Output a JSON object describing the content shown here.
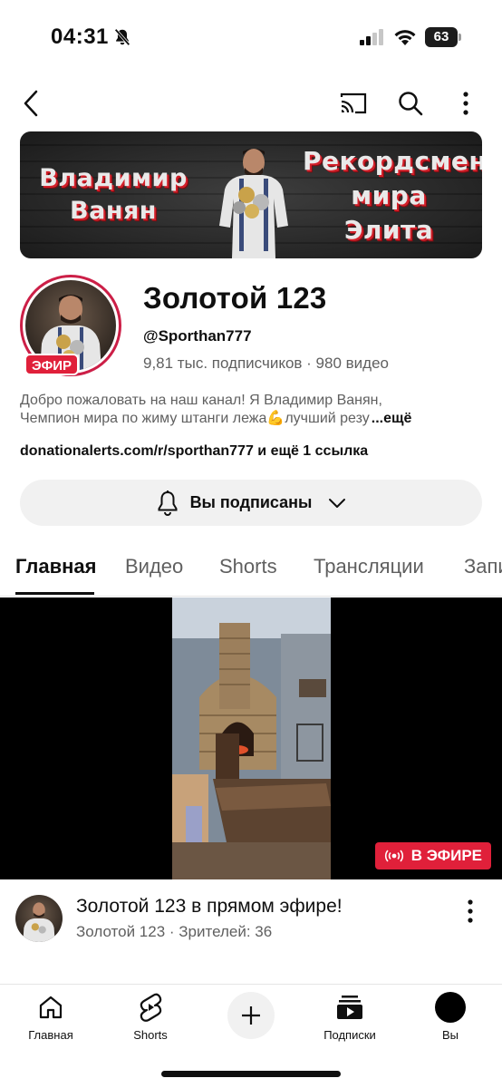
{
  "status_bar": {
    "time": "04:31",
    "battery": "63"
  },
  "banner": {
    "left_line1": "Владимир",
    "left_line2": "Ванян",
    "right_line1": "Рекордсмен",
    "right_line2": "мира",
    "right_line3": "Элита"
  },
  "channel": {
    "name": "Золотой 123",
    "handle": "@Sporthan777",
    "stats": "9,81 тыс. подписчиков  ·  980 видео",
    "live_tag": "ЭФИР",
    "description_line1": "Добро пожаловать на наш канал! Я Владимир Ванян,",
    "description_line2": "Чемпион мира по жиму штанги лежа💪лучший резу",
    "description_more": "...ещё",
    "links": "donationalerts.com/r/sporthan777 и ещё 1 ссылка",
    "subscribe_label": "Вы подписаны"
  },
  "tabs": [
    {
      "label": "Главная",
      "active": true
    },
    {
      "label": "Видео",
      "active": false
    },
    {
      "label": "Shorts",
      "active": false
    },
    {
      "label": "Трансляции",
      "active": false
    },
    {
      "label": "Запи",
      "active": false
    }
  ],
  "live_video": {
    "badge": "В ЭФИРЕ",
    "title": "Золотой 123 в прямом эфире!",
    "subtitle": "Золотой 123 · Зрителей: 36"
  },
  "bottom_nav": {
    "home": "Главная",
    "shorts": "Shorts",
    "subscriptions": "Подписки",
    "you": "Вы"
  },
  "colors": {
    "accent_red": "#e0203a",
    "avatar_ring": "#cc1f47",
    "text_primary": "#0f0f0f",
    "text_secondary": "#606060",
    "button_bg": "#f1f1f1"
  }
}
